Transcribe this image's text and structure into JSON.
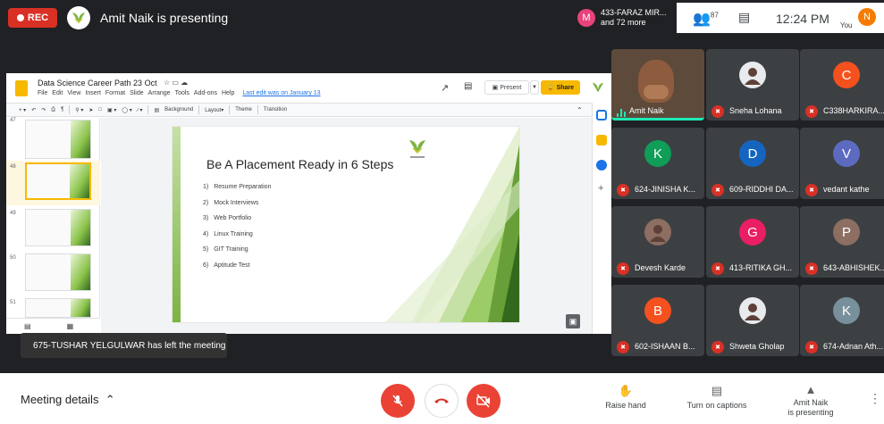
{
  "topbar": {
    "rec_label": "REC",
    "presenting_title": "Amit Naik is presenting",
    "raised_avatar": "M",
    "raised_text_1": "433-FARAZ MIR...",
    "raised_text_2": "and 72 more",
    "people_count": "87",
    "clock": "12:24 PM",
    "you_avatar": "N",
    "you_label": "You"
  },
  "slides_app": {
    "doc_title": "Data Science Career Path 23 Oct",
    "menus": [
      "File",
      "Edit",
      "View",
      "Insert",
      "Format",
      "Slide",
      "Arrange",
      "Tools",
      "Add-ons",
      "Help"
    ],
    "last_edit": "Last edit was on January 13",
    "present_label": "Present",
    "share_label": "Share",
    "toolbar": [
      "Background",
      "Layout",
      "Theme",
      "Transition"
    ],
    "thumb_numbers": [
      "47",
      "48",
      "49",
      "50",
      "51"
    ]
  },
  "slide": {
    "title": "Be A Placement Ready in 6 Steps",
    "steps": [
      {
        "num": "1)",
        "text": "Resume Preparation"
      },
      {
        "num": "2)",
        "text": "Mock Interviews"
      },
      {
        "num": "3)",
        "text": "Web Portfolio"
      },
      {
        "num": "4)",
        "text": "Linux Training"
      },
      {
        "num": "5)",
        "text": "GIT Training"
      },
      {
        "num": "6)",
        "text": "Aptitude Test"
      }
    ]
  },
  "toast": "675-TUSHAR YELGULWAR has left the meeting",
  "participants": [
    {
      "name": "Amit Naik",
      "initial": "",
      "color": "",
      "host": true
    },
    {
      "name": "Sneha Lohana",
      "initial": "",
      "color": "#e8eaed"
    },
    {
      "name": "C338HARKIRA...",
      "initial": "C",
      "color": "#f4511e"
    },
    {
      "name": "624-JINISHA K...",
      "initial": "K",
      "color": "#0f9d58"
    },
    {
      "name": "609-RIDDHI DA...",
      "initial": "D",
      "color": "#1565c0"
    },
    {
      "name": "vedant kathe",
      "initial": "V",
      "color": "#5c6bc0"
    },
    {
      "name": "Devesh Karde",
      "initial": "",
      "color": "#8d6e63"
    },
    {
      "name": "413-RITIKA GH...",
      "initial": "G",
      "color": "#e91e63"
    },
    {
      "name": "643-ABHISHEK...",
      "initial": "P",
      "color": "#8d6e63"
    },
    {
      "name": "602-ISHAAN B...",
      "initial": "B",
      "color": "#f4511e"
    },
    {
      "name": "Shweta Gholap",
      "initial": "",
      "color": "#e8eaed"
    },
    {
      "name": "674-Adnan Ath...",
      "initial": "K",
      "color": "#78909c"
    }
  ],
  "bottombar": {
    "meeting_details": "Meeting details",
    "raise_hand": "Raise hand",
    "captions": "Turn on captions",
    "presenting_1": "Amit Naik",
    "presenting_2": "is presenting"
  }
}
